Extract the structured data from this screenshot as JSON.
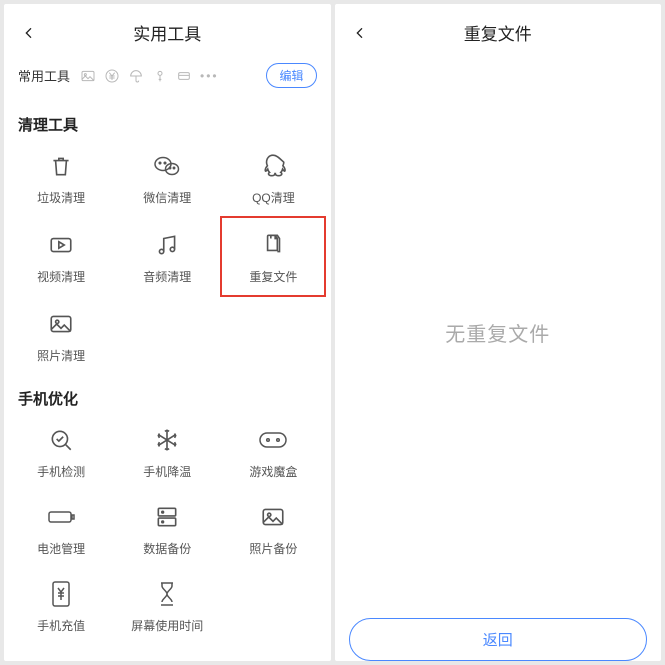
{
  "left": {
    "title": "实用工具",
    "fav_label": "常用工具",
    "edit_label": "编辑",
    "sections": {
      "clean": {
        "title": "清理工具",
        "tools": [
          {
            "label": "垃圾清理",
            "icon": "trash"
          },
          {
            "label": "微信清理",
            "icon": "wechat"
          },
          {
            "label": "QQ清理",
            "icon": "qq"
          },
          {
            "label": "视频清理",
            "icon": "video"
          },
          {
            "label": "音频清理",
            "icon": "audio"
          },
          {
            "label": "重复文件",
            "icon": "duplicate",
            "highlight": true
          },
          {
            "label": "照片清理",
            "icon": "photo"
          }
        ]
      },
      "opt": {
        "title": "手机优化",
        "tools": [
          {
            "label": "手机检测",
            "icon": "diag"
          },
          {
            "label": "手机降温",
            "icon": "snow"
          },
          {
            "label": "游戏魔盒",
            "icon": "gamepad"
          },
          {
            "label": "电池管理",
            "icon": "battery"
          },
          {
            "label": "数据备份",
            "icon": "backup"
          },
          {
            "label": "照片备份",
            "icon": "photo"
          },
          {
            "label": "手机充值",
            "icon": "yen"
          },
          {
            "label": "屏幕使用时间",
            "icon": "hourglass"
          }
        ]
      }
    }
  },
  "right": {
    "title": "重复文件",
    "empty": "无重复文件",
    "return": "返回"
  }
}
